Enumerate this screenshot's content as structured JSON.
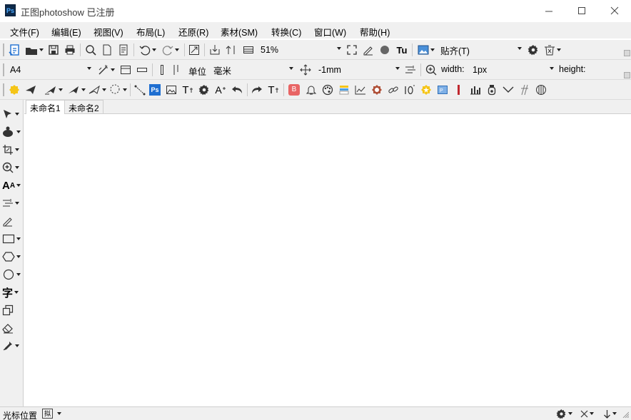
{
  "window": {
    "title": "正图photoshow 已注册",
    "logo_text": "Ps"
  },
  "menu": [
    "文件(F)",
    "编辑(E)",
    "视图(V)",
    "布局(L)",
    "还原(R)",
    "素材(SM)",
    "转换(C)",
    "窗口(W)",
    "帮助(H)"
  ],
  "toolbar1": {
    "zoom": "51%",
    "snap": "贴齐(T)",
    "tu_label": "Tu"
  },
  "toolbar2": {
    "paper": "A4",
    "unit_label": "单位",
    "unit": "毫米",
    "offset": "-1mm",
    "width_label": "width:",
    "width_value": "1px",
    "height_label": "height:"
  },
  "toolbar3": {
    "ps_badge": "Ps",
    "b_badge": "B",
    "text_t": "T"
  },
  "tabs": [
    "未命名1",
    "未命名2"
  ],
  "tools_text": {
    "text_tool": "字",
    "font_tool": "A"
  },
  "status": {
    "cursor_label": "光标位置",
    "chip": "拟"
  },
  "colors": {
    "accent": "#1f6fd1",
    "red": "#e0403a",
    "chrome": "#f0f0f0"
  }
}
